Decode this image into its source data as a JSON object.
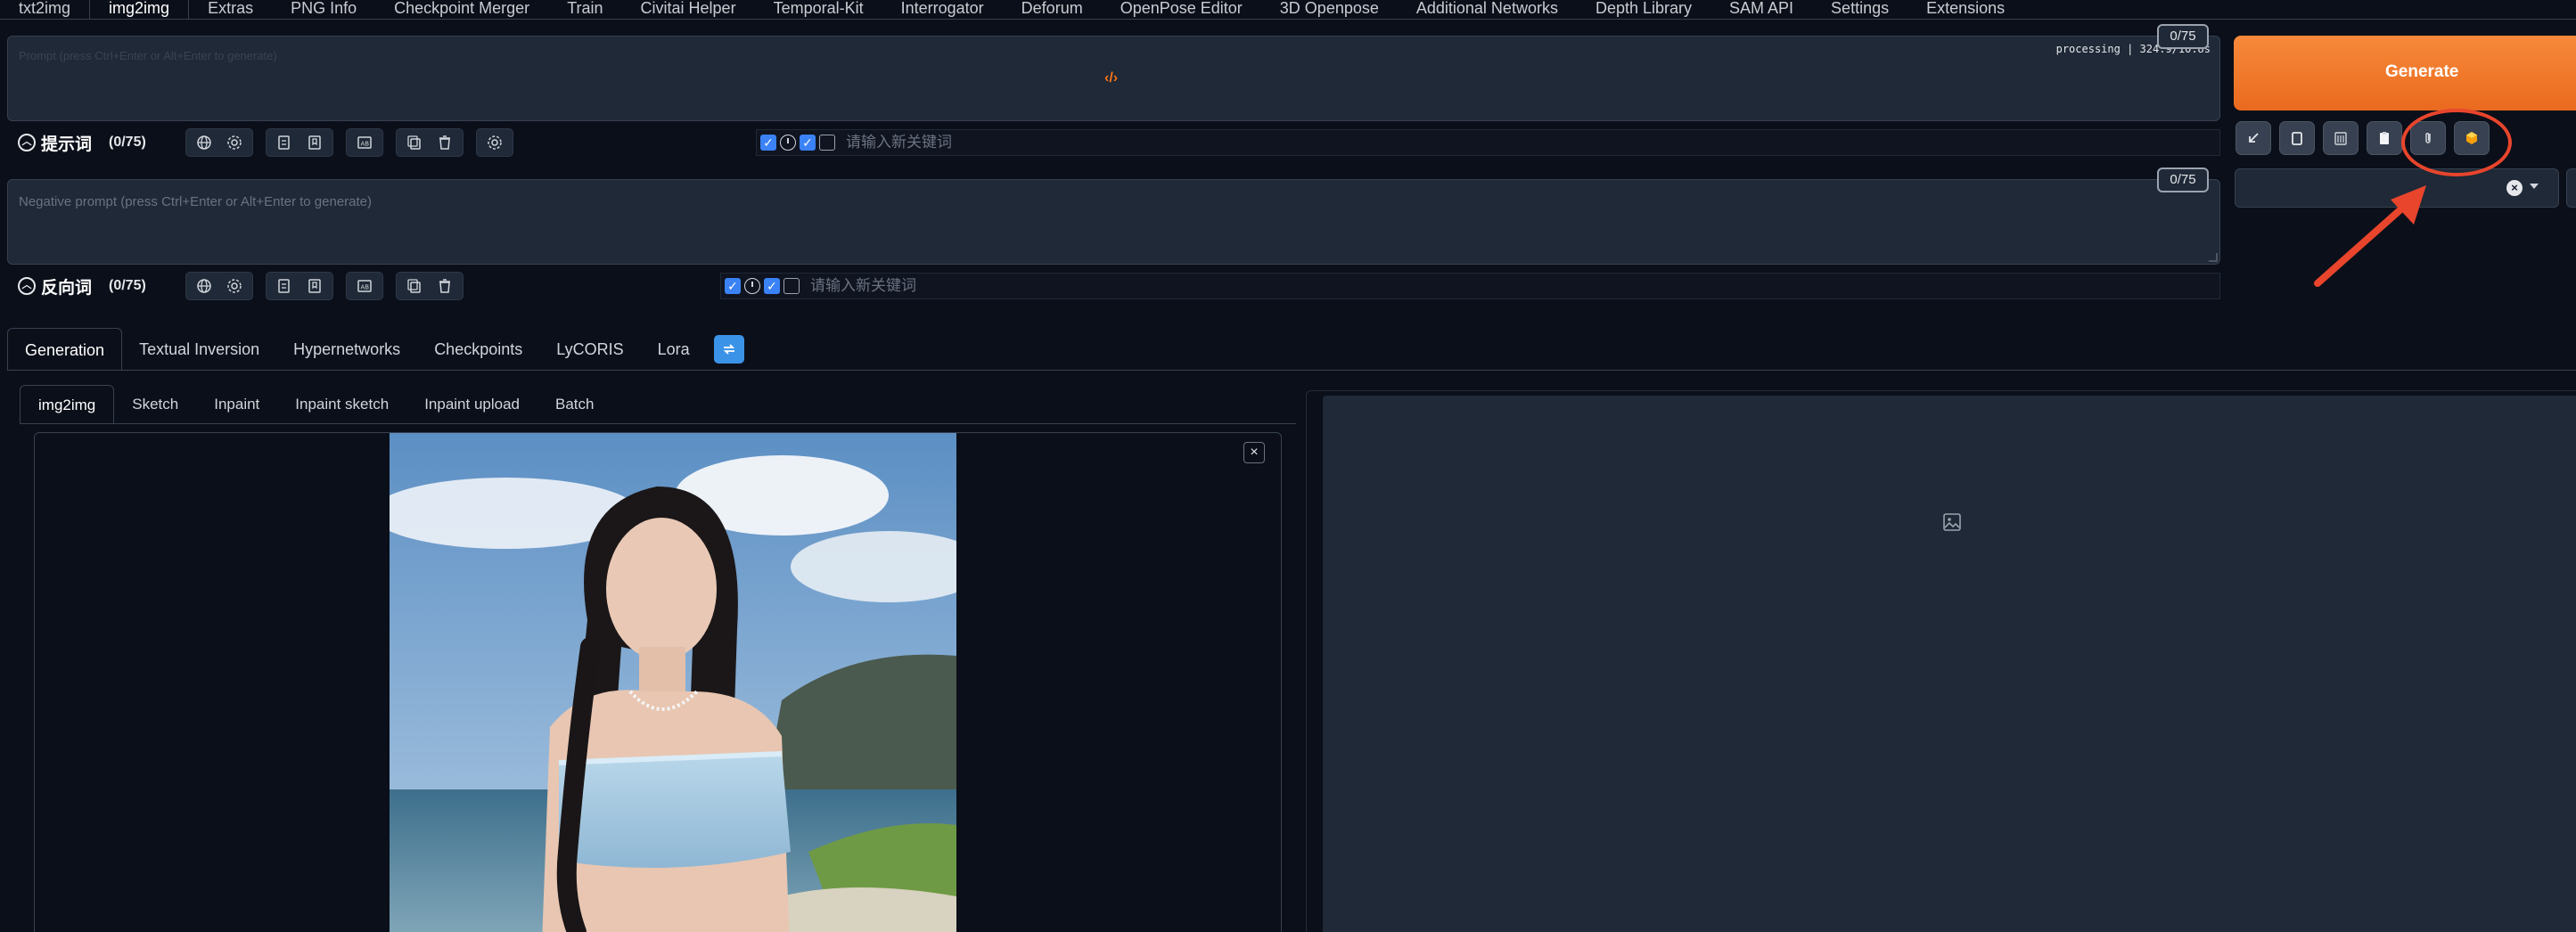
{
  "top_tabs": [
    {
      "label": "txt2img",
      "active": false
    },
    {
      "label": "img2img",
      "active": true
    },
    {
      "label": "Extras",
      "active": false
    },
    {
      "label": "PNG Info",
      "active": false
    },
    {
      "label": "Checkpoint Merger",
      "active": false
    },
    {
      "label": "Train",
      "active": false
    },
    {
      "label": "Civitai Helper",
      "active": false
    },
    {
      "label": "Temporal-Kit",
      "active": false
    },
    {
      "label": "Interrogator",
      "active": false
    },
    {
      "label": "Deforum",
      "active": false
    },
    {
      "label": "OpenPose Editor",
      "active": false
    },
    {
      "label": "3D Openpose",
      "active": false
    },
    {
      "label": "Additional Networks",
      "active": false
    },
    {
      "label": "Depth Library",
      "active": false
    },
    {
      "label": "SAM API",
      "active": false
    },
    {
      "label": "Settings",
      "active": false
    },
    {
      "label": "Extensions",
      "active": false
    }
  ],
  "prompt": {
    "placeholder": "Prompt (press Ctrl+Enter or Alt+Enter to generate)",
    "counter": "0/75",
    "processing": "processing | 324.9/10.8s",
    "toolbar_title": "提示词",
    "toolbar_count": "(0/75)",
    "keyword_placeholder": "请输入新关键词"
  },
  "negative_prompt": {
    "placeholder": "Negative prompt (press Ctrl+Enter or Alt+Enter to generate)",
    "counter": "0/75",
    "toolbar_title": "反向词",
    "toolbar_count": "(0/75)",
    "keyword_placeholder": "请输入新关键词"
  },
  "generate": {
    "label": "Generate",
    "color": "#f07a2e"
  },
  "right_tool_icons": [
    "arrow-icon",
    "trash-icon",
    "clipboard-icon",
    "clip-icon",
    "box-icon"
  ],
  "annotation_color": "#e8452c",
  "network_tabs": [
    {
      "label": "Generation",
      "active": true
    },
    {
      "label": "Textual Inversion",
      "active": false
    },
    {
      "label": "Hypernetworks",
      "active": false
    },
    {
      "label": "Checkpoints",
      "active": false
    },
    {
      "label": "LyCORIS",
      "active": false
    },
    {
      "label": "Lora",
      "active": false
    }
  ],
  "img2img_tabs": [
    {
      "label": "img2img",
      "active": true
    },
    {
      "label": "Sketch",
      "active": false
    },
    {
      "label": "Inpaint",
      "active": false
    },
    {
      "label": "Inpaint sketch",
      "active": false
    },
    {
      "label": "Inpaint upload",
      "active": false
    },
    {
      "label": "Batch",
      "active": false
    }
  ],
  "image_close": "×",
  "style_clear": "×"
}
